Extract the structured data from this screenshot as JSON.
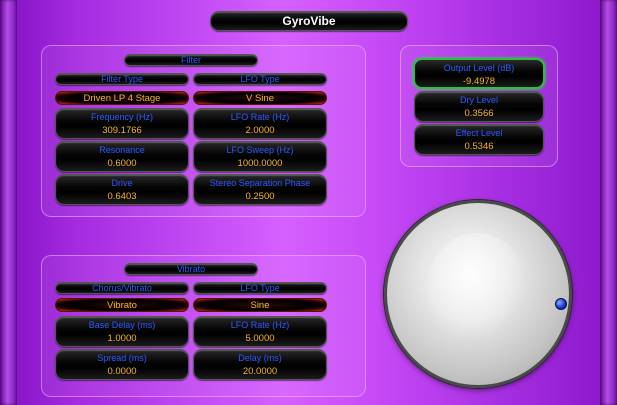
{
  "title": "GyroVibe",
  "filter": {
    "header": "Filter",
    "filter_type": {
      "label": "Filter Type",
      "value": "Driven LP 4 Stage"
    },
    "lfo_type": {
      "label": "LFO Type",
      "value": "V Sine"
    },
    "frequency": {
      "label": "Frequency (Hz)",
      "value": "309.1766"
    },
    "lfo_rate": {
      "label": "LFO Rate (Hz)",
      "value": "2.0000"
    },
    "resonance": {
      "label": "Resonance",
      "value": "0.6000"
    },
    "lfo_sweep": {
      "label": "LFO Sweep (Hz)",
      "value": "1000.0000"
    },
    "drive": {
      "label": "Drive",
      "value": "0.6403"
    },
    "stereo_phase": {
      "label": "Stereo Separation Phase",
      "value": "0.2500"
    }
  },
  "vibrato": {
    "header": "Vibrato",
    "mode": {
      "label": "Chorus/Vibrato",
      "value": "Vibrato"
    },
    "lfo_type": {
      "label": "LFO Type",
      "value": "Sine"
    },
    "base_delay": {
      "label": "Base Delay (ms)",
      "value": "1.0000"
    },
    "lfo_rate": {
      "label": "LFO Rate (Hz)",
      "value": "5.0000"
    },
    "spread": {
      "label": "Spread (ms)",
      "value": "0.0000"
    },
    "delay": {
      "label": "Delay (ms)",
      "value": "20.0000"
    }
  },
  "output": {
    "output_level": {
      "label": "Output Level (dB)",
      "value": "-9.4978"
    },
    "dry_level": {
      "label": "Dry Level",
      "value": "0.3566"
    },
    "effect_level": {
      "label": "Effect Level",
      "value": "0.5346"
    }
  },
  "colors": {
    "label_text": "#2f57ff",
    "value_text": "#f0b430",
    "title_text": "#ffffff",
    "highlight": "#28c23c"
  }
}
